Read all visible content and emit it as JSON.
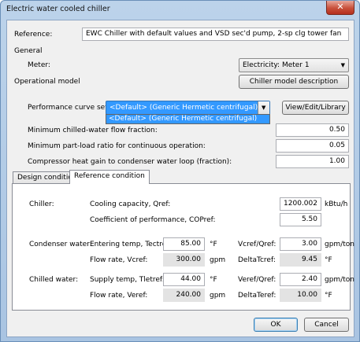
{
  "window": {
    "title": "Electric water cooled chiller",
    "close_label": "✕"
  },
  "reference": {
    "label": "Reference:",
    "value": "EWC Chiller with default values and VSD sec'd pump, 2-sp clg tower fan"
  },
  "general": {
    "heading": "General",
    "meter_label": "Meter:",
    "meter_value": "Electricity: Meter 1"
  },
  "operational": {
    "heading": "Operational model",
    "description_button": "Chiller model description",
    "curve_label": "Performance curve set:",
    "curve_value": "<Default> (Generic Hermetic centrifugal)",
    "curve_option": "<Default> (Generic Hermetic centrifugal)",
    "view_button": "View/Edit/Library",
    "min_flow_label": "Minimum chilled-water flow fraction:",
    "min_flow_value": "0.50",
    "min_plr_label": "Minimum part-load ratio for continuous operation:",
    "min_plr_value": "0.05",
    "comp_heat_label": "Compressor heat gain to condenser water loop (fraction):",
    "comp_heat_value": "1.00"
  },
  "tabs": [
    {
      "label": "Design condition"
    },
    {
      "label": "Reference condition"
    }
  ],
  "chiller": {
    "label": "Chiller:",
    "capacity_label": "Cooling capacity, Qref:",
    "capacity_value": "1200.002",
    "capacity_unit": "kBtu/h",
    "cop_label": "Coefficient of performance, COPref:",
    "cop_value": "5.50"
  },
  "condenser": {
    "label": "Condenser water:",
    "temp_label": "Entering temp, Tectref:",
    "temp_value": "85.00",
    "temp_unit": "°F",
    "ratio_label": "Vcref/Qref:",
    "ratio_value": "3.00",
    "ratio_unit": "gpm/ton",
    "flow_label": "Flow rate, Vcref:",
    "flow_value": "300.00",
    "flow_unit": "gpm",
    "delta_label": "DeltaTcref:",
    "delta_value": "9.45",
    "delta_unit": "°F"
  },
  "chilled": {
    "label": "Chilled water:",
    "temp_label": "Supply temp, Tletref:",
    "temp_value": "44.00",
    "temp_unit": "°F",
    "ratio_label": "Veref/Qref:",
    "ratio_value": "2.40",
    "ratio_unit": "gpm/ton",
    "flow_label": "Flow rate, Veref:",
    "flow_value": "240.00",
    "flow_unit": "gpm",
    "delta_label": "DeltaTeref:",
    "delta_value": "10.00",
    "delta_unit": "°F"
  },
  "footer": {
    "ok": "OK",
    "cancel": "Cancel"
  }
}
